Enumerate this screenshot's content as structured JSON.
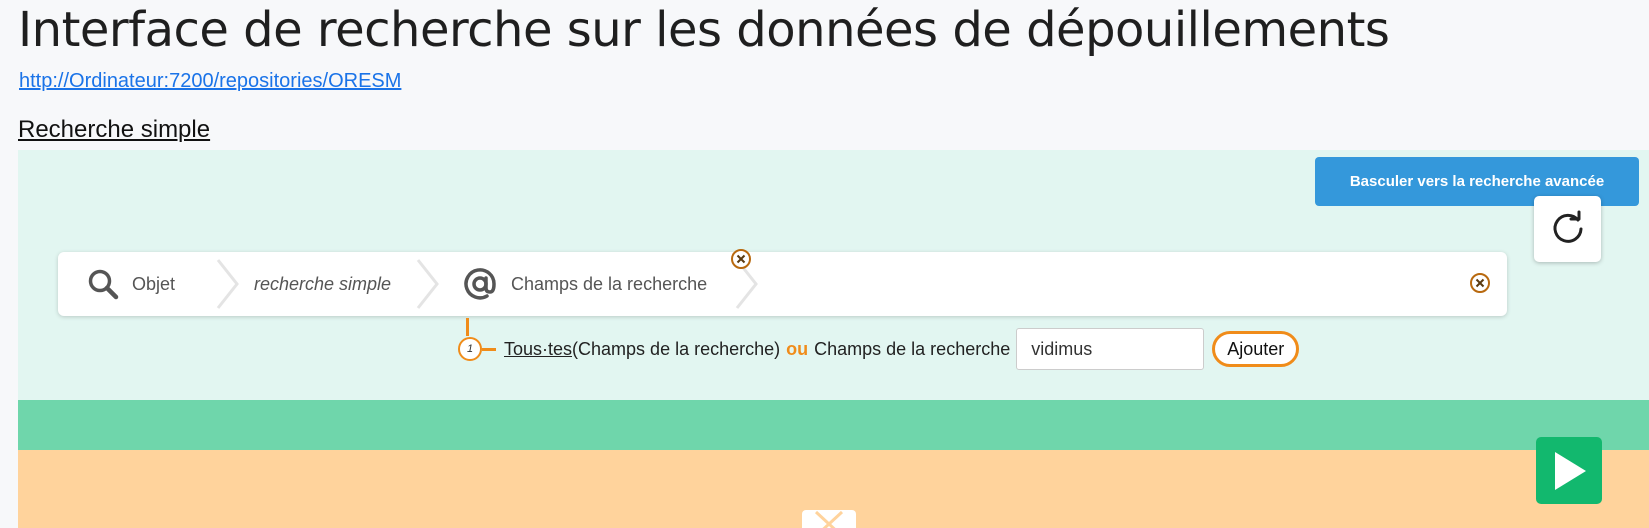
{
  "page": {
    "title": "Interface de recherche sur les données de dépouillements",
    "repository_url": "http://Ordinateur:7200/repositories/ORESM",
    "section_title": "Recherche simple"
  },
  "toolbar": {
    "toggle_label": "Basculer vers la recherche avancée",
    "refresh_icon": "refresh-icon",
    "run_icon": "play-icon"
  },
  "search_bar": {
    "crumbs": [
      {
        "icon": "search-icon",
        "label": "Objet"
      },
      {
        "icon": null,
        "label": "recherche simple"
      },
      {
        "icon": "at-icon",
        "label": "Champs de la recherche"
      }
    ]
  },
  "criteria": {
    "index": "1",
    "quantifier": "Tous·tes ",
    "quantifier_detail": "(Champs de la recherche)",
    "operator": "ou",
    "field_label": "Champs de la recherche",
    "value": "vidimus",
    "add_label": "Ajouter"
  },
  "colors": {
    "panel": "#e2f6f1",
    "green_band": "#6fd6ab",
    "orange_band": "#ffd39c",
    "accent": "#f08c1a",
    "toggle": "#3498db",
    "play": "#12b86e"
  }
}
